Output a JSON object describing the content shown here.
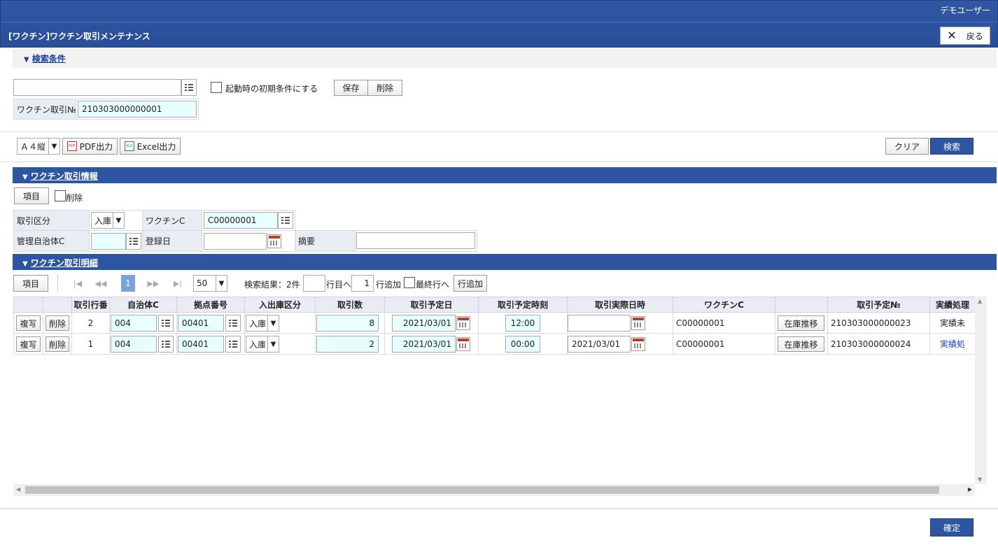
{
  "header": {
    "user": "デモユーザー",
    "title": "[ワクチン]ワクチン取引メンテナンス",
    "back_label": "戻る"
  },
  "search": {
    "section_title": "検索条件",
    "condition_value": "",
    "initial_checkbox_label": "起動時の初期条件にする",
    "save_label": "保存",
    "delete_label": "削除",
    "field_label": "ワクチン取引№",
    "field_value": "210303000000001"
  },
  "toolbar": {
    "paper": "Ａ４縦",
    "pdf_label": "PDF出力",
    "excel_label": "Excel出力",
    "clear_label": "クリア",
    "search_label": "検索"
  },
  "info": {
    "section_title": "ワクチン取引情報",
    "items_label": "項目",
    "delete_label": "削除",
    "trade_type_label": "取引区分",
    "trade_type_value": "入庫",
    "vaccine_code_label": "ワクチンC",
    "vaccine_code_value": "C00000001",
    "municipality_label": "管理自治体C",
    "municipality_value": "",
    "reg_date_label": "登録日",
    "reg_date_value": "",
    "summary_label": "摘要",
    "summary_value": ""
  },
  "detail": {
    "section_title": "ワクチン取引明細",
    "items_label": "項目",
    "current_page": "1",
    "page_size": "50",
    "result_text": "検索結果：2件",
    "goto_row_value": "",
    "goto_row_label": "行目へ",
    "add_count_value": "1",
    "add_row_label": "行追加",
    "last_row_label": "最終行へ",
    "add_row_button": "行追加",
    "columns": [
      "",
      "",
      "取引行番",
      "自治体C",
      "拠点番号",
      "入出庫区分",
      "取引数",
      "取引予定日",
      "取引予定時刻",
      "取引実際日時",
      "ワクチンC",
      "",
      "取引予定№",
      "実績処理"
    ],
    "copy_label": "複写",
    "row_delete_label": "削除",
    "stock_label": "在庫推移",
    "rows": [
      {
        "line_no": "2",
        "municipality": "004",
        "base_no": "00401",
        "io_type": "入庫",
        "quantity": "8",
        "plan_date": "2021/03/01",
        "plan_time": "12:00",
        "actual_datetime": "",
        "vaccine_code": "C00000001",
        "plan_no": "210303000000023",
        "status": "実績未"
      },
      {
        "line_no": "1",
        "municipality": "004",
        "base_no": "00401",
        "io_type": "入庫",
        "quantity": "2",
        "plan_date": "2021/03/01",
        "plan_time": "00:00",
        "actual_datetime": "2021/03/01",
        "vaccine_code": "C00000001",
        "plan_no": "210303000000024",
        "status": "実績処"
      }
    ]
  },
  "footer": {
    "confirm_label": "確定"
  }
}
